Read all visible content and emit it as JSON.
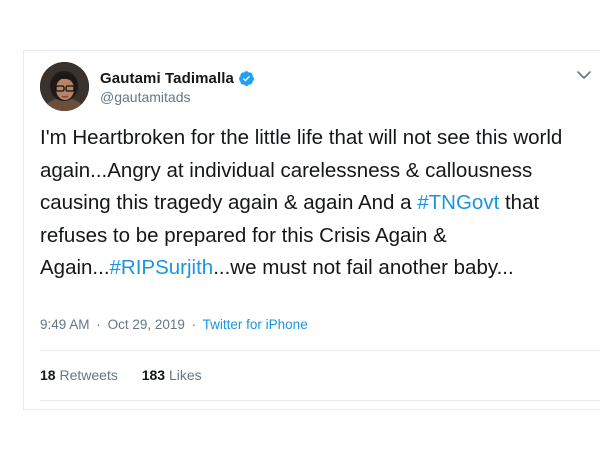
{
  "tweet": {
    "display_name": "Gautami Tadimalla",
    "handle": "@gautamitads",
    "verified": true,
    "avatar_icon": "user-avatar",
    "menu_icon": "chevron-down-icon",
    "text_parts": {
      "p1": "I'm Heartbroken for the little life that will not see this world again...Angry at individual carelessness & callousness causing this tragedy again & again And a ",
      "hashtag1": "#TNGovt",
      "p2": " that refuses to be prepared for this Crisis Again & Again...",
      "hashtag2": "#RIPSurjith",
      "p3": "...we must not fail another baby..."
    },
    "time": "9:49 AM",
    "date": "Oct 29, 2019",
    "separator": "·",
    "source": "Twitter for iPhone",
    "retweets_count": "18",
    "retweets_label": "Retweets",
    "likes_count": "183",
    "likes_label": "Likes"
  },
  "colors": {
    "text": "#14171a",
    "secondary": "#657786",
    "link": "#1b95e0",
    "verified": "#1da1f2",
    "border": "#e6ecf0"
  }
}
